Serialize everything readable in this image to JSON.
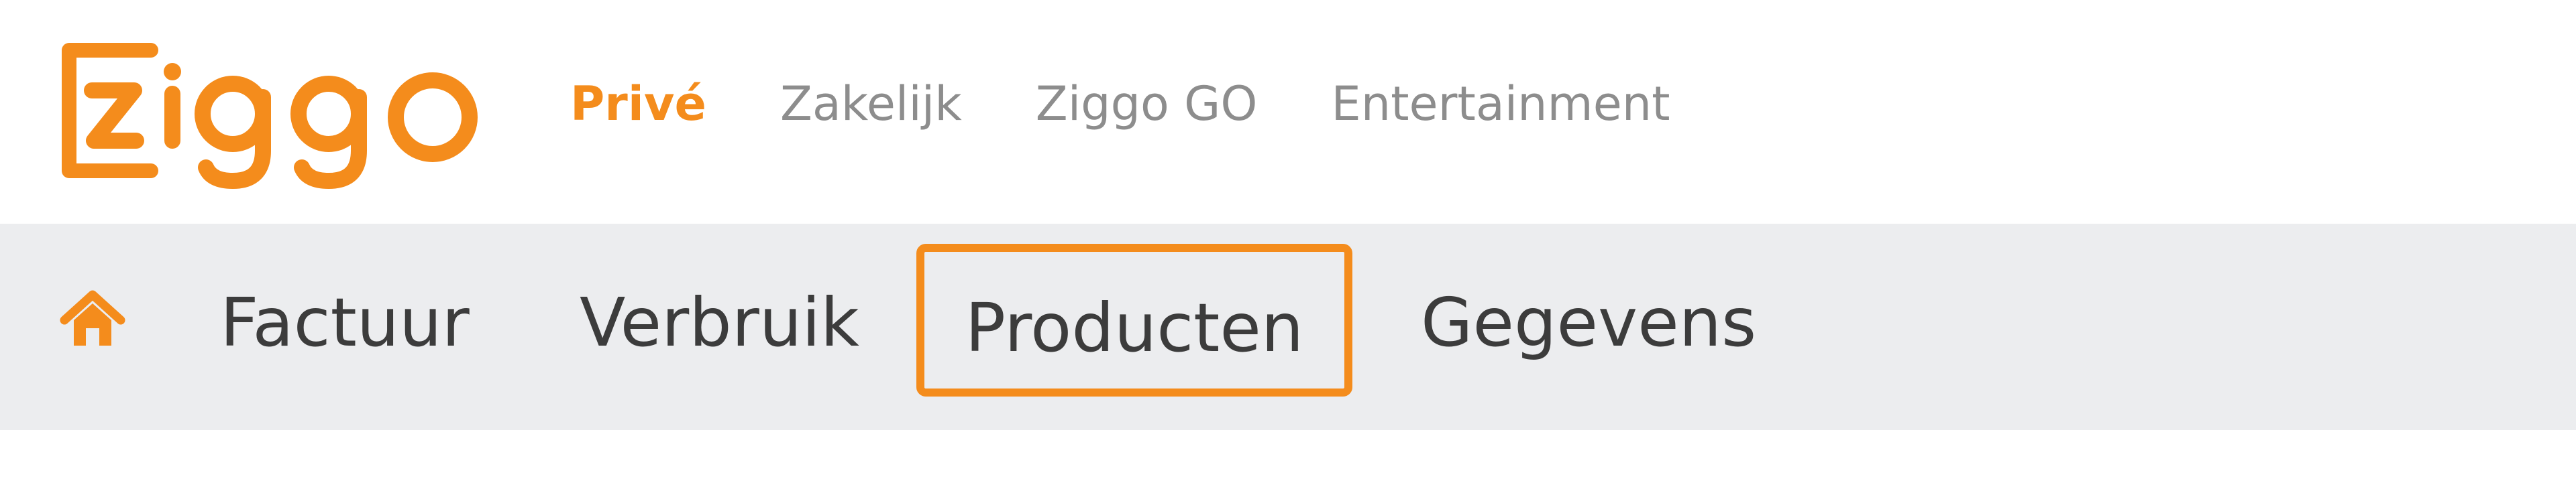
{
  "brand": {
    "logo_text": "ziggo",
    "accent_color": "#f48c1c",
    "icon": "ziggo-logo"
  },
  "top_nav": {
    "items": [
      {
        "label": "Privé",
        "active": true
      },
      {
        "label": "Zakelijk",
        "active": false
      },
      {
        "label": "Ziggo GO",
        "active": false
      },
      {
        "label": "Entertainment",
        "active": false
      }
    ]
  },
  "sub_nav": {
    "home_icon": "home-icon",
    "items": [
      {
        "label": "Factuur",
        "highlighted": false
      },
      {
        "label": "Verbruik",
        "highlighted": false
      },
      {
        "label": "Producten",
        "highlighted": true
      },
      {
        "label": "Gegevens",
        "highlighted": false
      }
    ],
    "highlight_color": "#f48c1c"
  }
}
